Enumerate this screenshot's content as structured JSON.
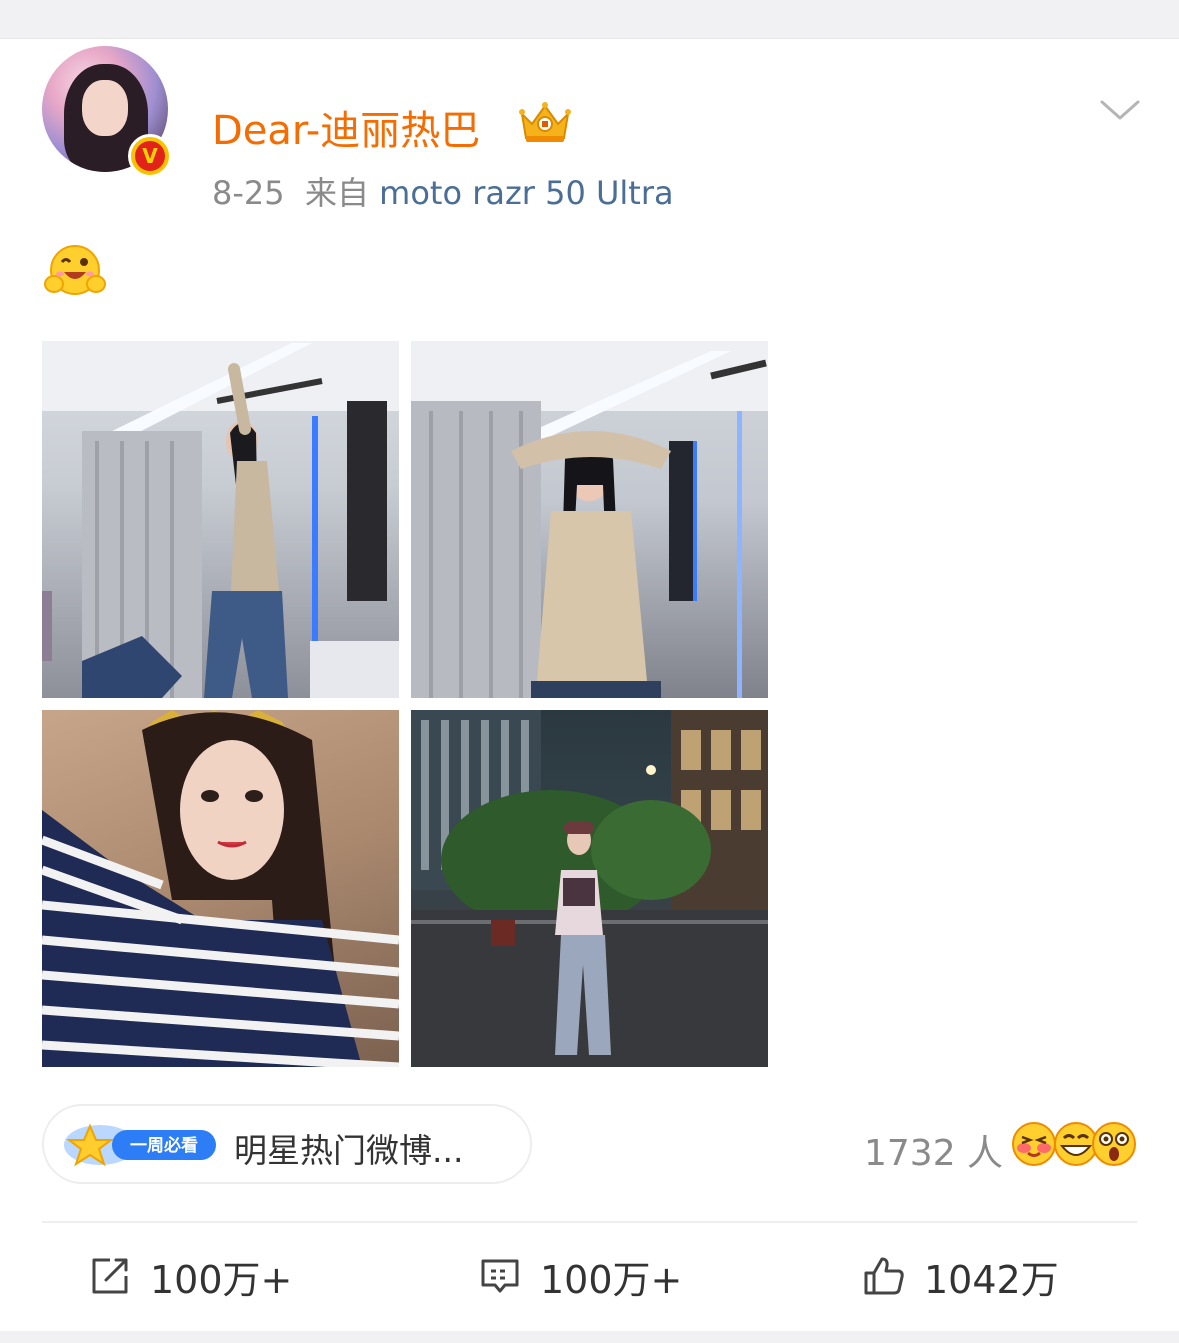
{
  "post": {
    "username": "Dear-迪丽热巴",
    "date": "8-25",
    "source_prefix": "来自",
    "device": "moto razr 50 Ultra",
    "body_emoji_icon": "happy-hugging-emoji-icon",
    "photos": [
      {
        "name": "photo-pose-arm-raised"
      },
      {
        "name": "photo-pose-hands-on-head"
      },
      {
        "name": "photo-selfie-striped-shirt"
      },
      {
        "name": "photo-night-street"
      }
    ]
  },
  "topic_tag": {
    "badge_label": "一周必看",
    "text": "明星热门微博..."
  },
  "reactions": {
    "count_label": "1732 人",
    "emoji_icons": [
      "blushing-emoji-icon",
      "grinning-emoji-icon",
      "shocked-emoji-icon"
    ]
  },
  "actions": {
    "repost": "100万+",
    "comment": "100万+",
    "like": "1042万"
  },
  "colors": {
    "username": "#f56c00",
    "device_link": "#4b6e97",
    "meta_gray": "#8a8a8a",
    "badge_blue": "#2d7df6"
  }
}
